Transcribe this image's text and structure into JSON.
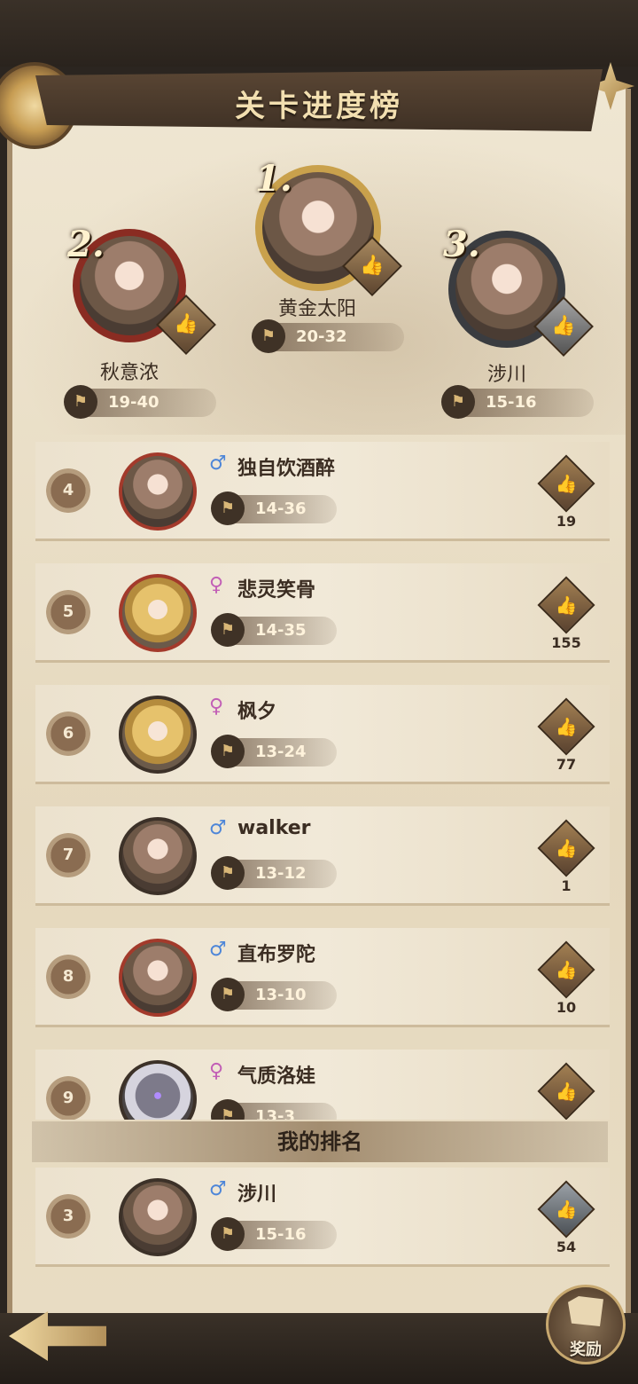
{
  "title": "关卡进度榜",
  "podium": [
    {
      "rank": "2.",
      "name": "秋意浓",
      "stage": "19-40",
      "like_icon": "thumbs-up-icon"
    },
    {
      "rank": "1.",
      "name": "黄金太阳",
      "stage": "20-32",
      "like_icon": "thumbs-up-icon"
    },
    {
      "rank": "3.",
      "name": "涉川",
      "stage": "15-16",
      "like_icon": "thumbs-up-icon"
    }
  ],
  "rows": [
    {
      "rank": "4",
      "gender": "♂",
      "name": "独自饮酒醉",
      "stage": "14-36",
      "likes": "19"
    },
    {
      "rank": "5",
      "gender": "♀",
      "name": "悲灵笑骨",
      "stage": "14-35",
      "likes": "155"
    },
    {
      "rank": "6",
      "gender": "♀",
      "name": "枫夕",
      "stage": "13-24",
      "likes": "77"
    },
    {
      "rank": "7",
      "gender": "♂",
      "name": "walker",
      "stage": "13-12",
      "likes": "1"
    },
    {
      "rank": "8",
      "gender": "♂",
      "name": "直布罗陀",
      "stage": "13-10",
      "likes": "10"
    },
    {
      "rank": "9",
      "gender": "♀",
      "name": "气质洛娃",
      "stage": "13-3",
      "likes": ""
    }
  ],
  "my_rank_label": "我的排名",
  "my_rank": {
    "rank": "3",
    "gender": "♂",
    "name": "涉川",
    "stage": "15-16",
    "likes": "54"
  },
  "reward_label": "奖励",
  "colors": {
    "male": "#4e86d8",
    "female": "#c25fb6",
    "accent": "#c79d53"
  }
}
